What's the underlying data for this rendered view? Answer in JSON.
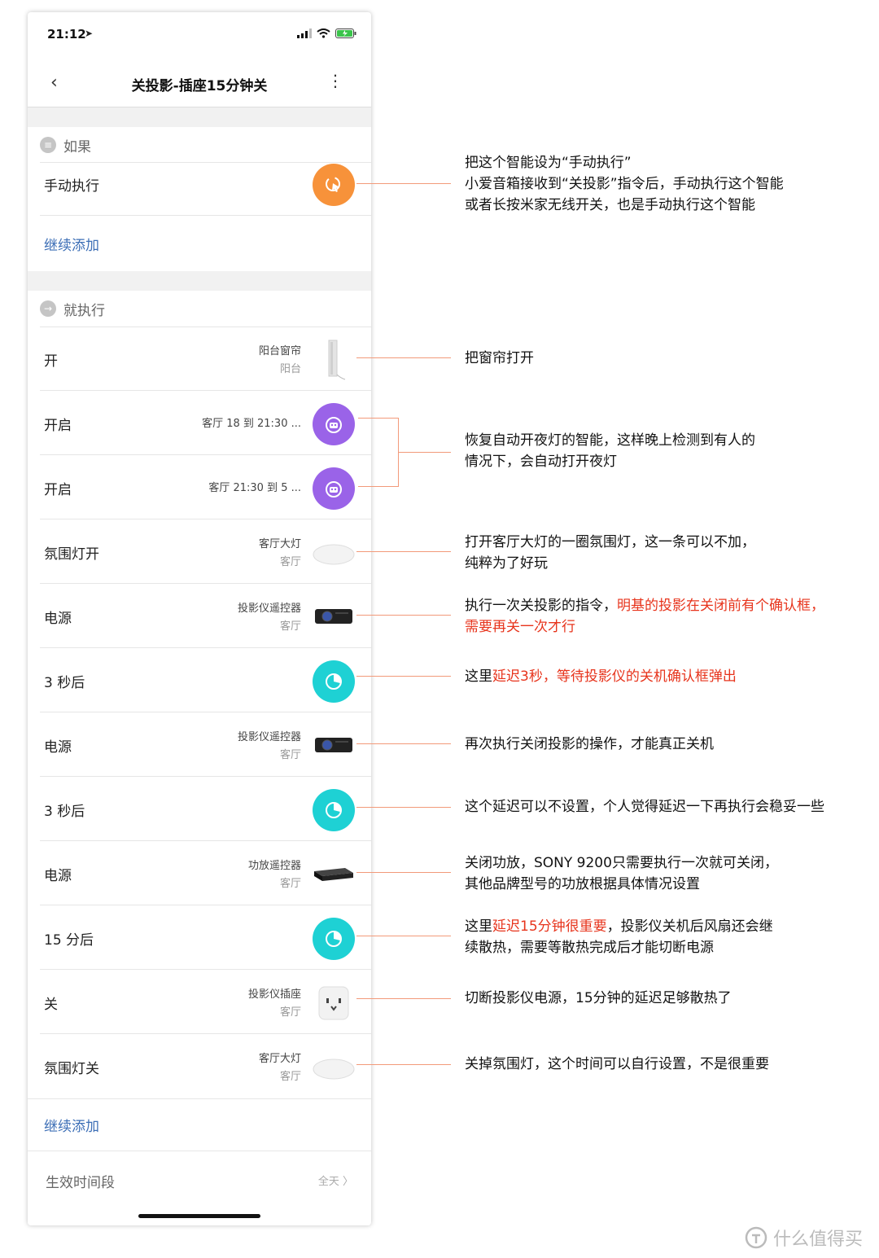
{
  "status_bar": {
    "time": "21:12"
  },
  "nav": {
    "title": "关投影-插座15分钟关"
  },
  "if_section": {
    "title": "如果",
    "trigger": "手动执行",
    "add_label": "继续添加"
  },
  "then_section": {
    "title": "就执行",
    "rows": [
      {
        "action": "开",
        "device": "阳台窗帘",
        "room": "阳台",
        "icon": "curtain-icon"
      },
      {
        "action": "开启",
        "device": "客厅 18 到 21:30 ...",
        "room": "",
        "icon": "automation-icon"
      },
      {
        "action": "开启",
        "device": "客厅 21:30 到 5 ...",
        "room": "",
        "icon": "automation-icon"
      },
      {
        "action": "氛围灯开",
        "device": "客厅大灯",
        "room": "客厅",
        "icon": "ceiling-light-icon"
      },
      {
        "action": "电源",
        "device": "投影仪遥控器",
        "room": "客厅",
        "icon": "projector-icon"
      },
      {
        "action": "3 秒后",
        "device": "",
        "room": "",
        "icon": "delay-icon"
      },
      {
        "action": "电源",
        "device": "投影仪遥控器",
        "room": "客厅",
        "icon": "projector-icon"
      },
      {
        "action": "3 秒后",
        "device": "",
        "room": "",
        "icon": "delay-icon"
      },
      {
        "action": "电源",
        "device": "功放遥控器",
        "room": "客厅",
        "icon": "amplifier-icon"
      },
      {
        "action": "15 分后",
        "device": "",
        "room": "",
        "icon": "delay-icon"
      },
      {
        "action": "关",
        "device": "投影仪插座",
        "room": "客厅",
        "icon": "power-socket-icon"
      },
      {
        "action": "氛围灯关",
        "device": "客厅大灯",
        "room": "客厅",
        "icon": "ceiling-light-icon"
      }
    ],
    "add_label": "继续添加"
  },
  "footer": {
    "label": "生效时间段",
    "value": "全天"
  },
  "colors": {
    "manual": "#f7923a",
    "automation": "#9a63e8",
    "delay": "#1ed1d4",
    "link": "#3d6fb6",
    "annotation_red": "#e7341c"
  },
  "annotations": {
    "a1": {
      "l1": "把这个智能设为“手动执行”",
      "l2": "小爱音箱接收到“关投影”指令后，手动执行这个智能",
      "l3": "或者长按米家无线开关，也是手动执行这个智能"
    },
    "a2": {
      "l1": "把窗帘打开"
    },
    "a3": {
      "l1": "恢复自动开夜灯的智能，这样晚上检测到有人的",
      "l2": "情况下，会自动打开夜灯"
    },
    "a4": {
      "l1": "打开客厅大灯的一圈氛围灯，这一条可以不加，",
      "l2": "纯粹为了好玩"
    },
    "a5": {
      "l1a": "执行一次关投影的指令，",
      "l1b": "明基的投影在关闭前有个确认框，",
      "l2": "需要再关一次才行"
    },
    "a6": {
      "pre": "这里",
      "red": "延迟3秒，等待投影仪的关机确认框弹出"
    },
    "a7": {
      "l1": "再次执行关闭投影的操作，才能真正关机"
    },
    "a8": {
      "l1": "这个延迟可以不设置，个人觉得延迟一下再执行会稳妥一些"
    },
    "a9": {
      "l1": "关闭功放，SONY 9200只需要执行一次就可关闭，",
      "l2": "其他品牌型号的功放根据具体情况设置"
    },
    "a10": {
      "pre": "这里",
      "red": "延迟15分钟很重要",
      "post": "，投影仪关机后风扇还会继",
      "l2": "续散热，需要等散热完成后才能切断电源"
    },
    "a11": {
      "l1": "切断投影仪电源，15分钟的延迟足够散热了"
    },
    "a12": {
      "l1": "关掉氛围灯，这个时间可以自行设置，不是很重要"
    }
  },
  "watermark": "什么值得买"
}
